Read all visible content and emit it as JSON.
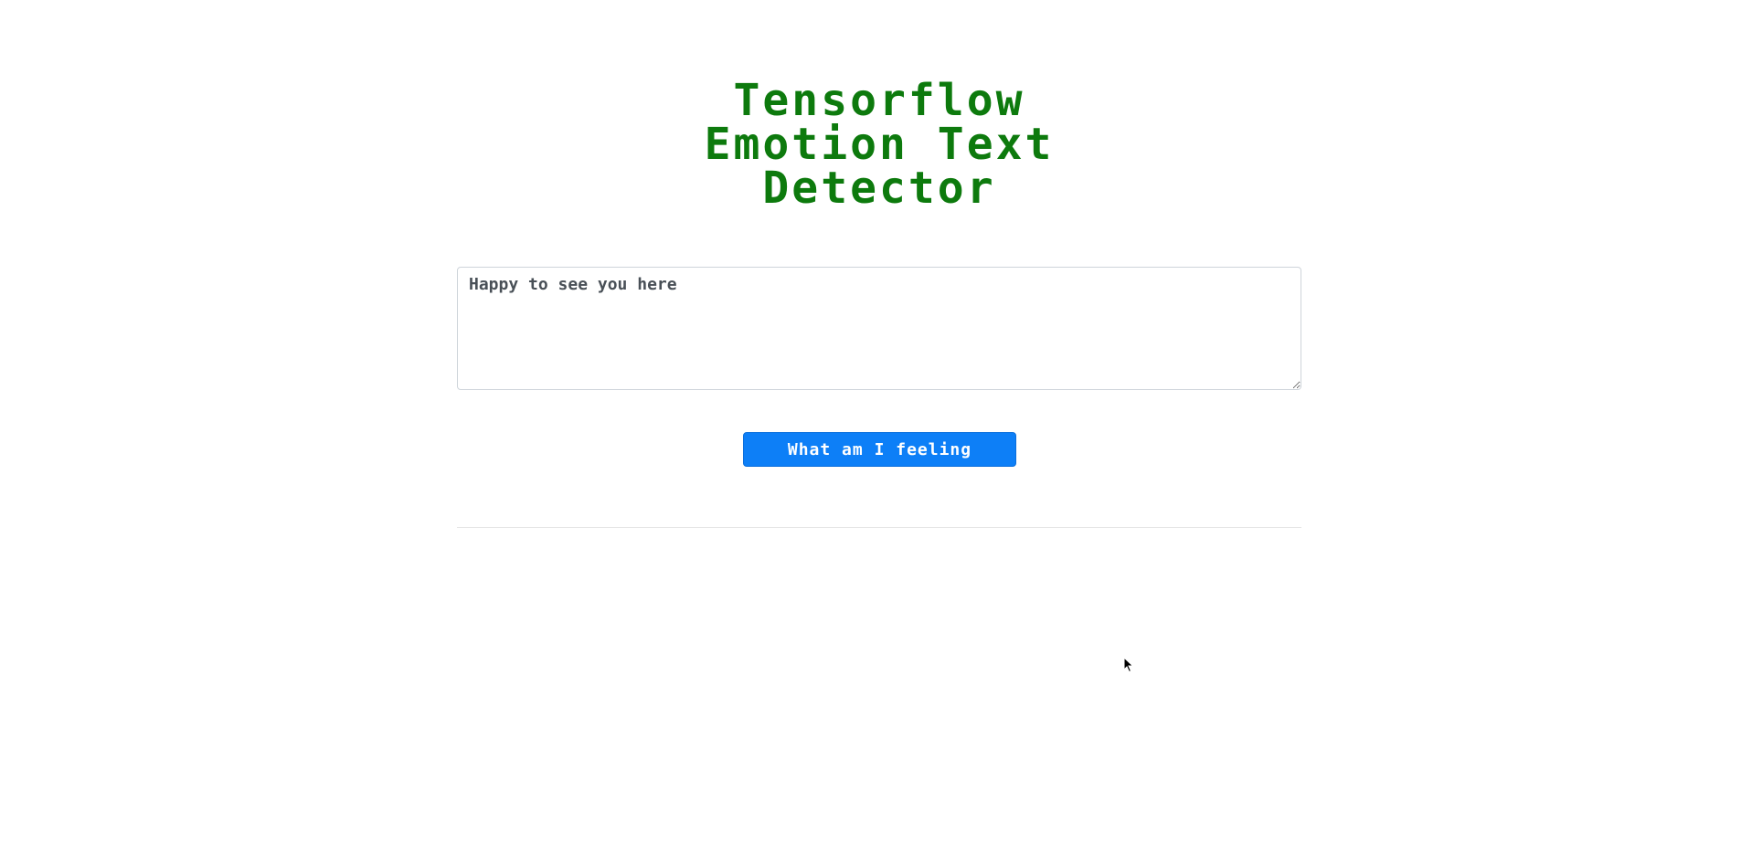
{
  "header": {
    "title_lines": [
      "Tensorflow",
      "Emotion Text",
      "Detector"
    ]
  },
  "form": {
    "text_value": "Happy to see you here",
    "submit_label": "What am I feeling"
  },
  "colors": {
    "title": "#0d7a0d",
    "button": "#0d7ff7",
    "divider": "#e5e5e5"
  },
  "icons": {
    "cursor": "mouse-pointer-icon"
  }
}
